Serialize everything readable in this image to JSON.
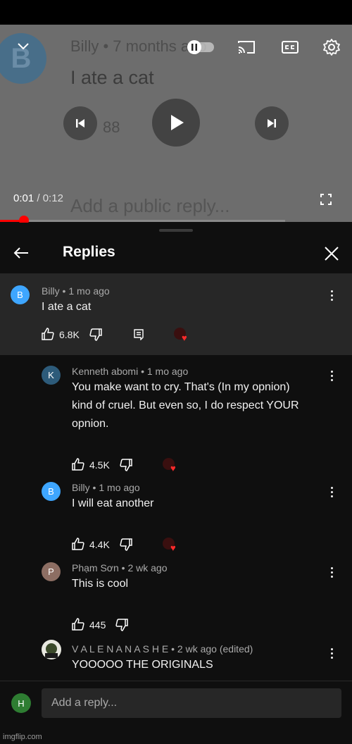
{
  "player": {
    "ghost": {
      "avatar_letter": "B",
      "name": "Billy",
      "age": "• 7 months ago",
      "text": "I ate a cat",
      "like_count": "88",
      "reply_placeholder": "Add a public reply..."
    },
    "time_current": "0:01",
    "time_separator": "/",
    "time_duration": "0:12",
    "progress_fraction": 0.0833,
    "progress_color": "#ff0000"
  },
  "panel": {
    "title": "Replies"
  },
  "main_comment": {
    "avatar_letter": "B",
    "avatar_color": "#3ea6ff",
    "meta": "Billy • 1 mo ago",
    "text": "I ate a cat",
    "likes": "6.8K"
  },
  "replies": [
    {
      "avatar_letter": "K",
      "avatar_color": "#2d5b7a",
      "meta": "Kenneth abomi • 1 mo ago",
      "text": "You make want to cry. That's (In my opnion) kind of cruel. But even so, I do respect YOUR opnion.",
      "likes": "4.5K",
      "hearted": true
    },
    {
      "avatar_letter": "B",
      "avatar_color": "#3ea6ff",
      "meta": "Billy • 1 mo ago",
      "text": "I will eat another",
      "likes": "4.4K",
      "hearted": true
    },
    {
      "avatar_letter": "P",
      "avatar_color": "#8d6e63",
      "meta": "Phạm Sơn • 2 wk ago",
      "text": "This is cool",
      "likes": "445",
      "hearted": false
    },
    {
      "avatar_letter": "",
      "avatar_color": "#2f3b2a",
      "meta": "V A L E N A N A S H E • 2 wk ago (edited)",
      "text": "YOOOOO THE ORIGINALS",
      "likes": "",
      "hearted": false
    }
  ],
  "reply_bar": {
    "avatar_letter": "H",
    "avatar_color": "#2e7d32",
    "placeholder": "Add a reply..."
  },
  "watermark": "imgflip.com"
}
